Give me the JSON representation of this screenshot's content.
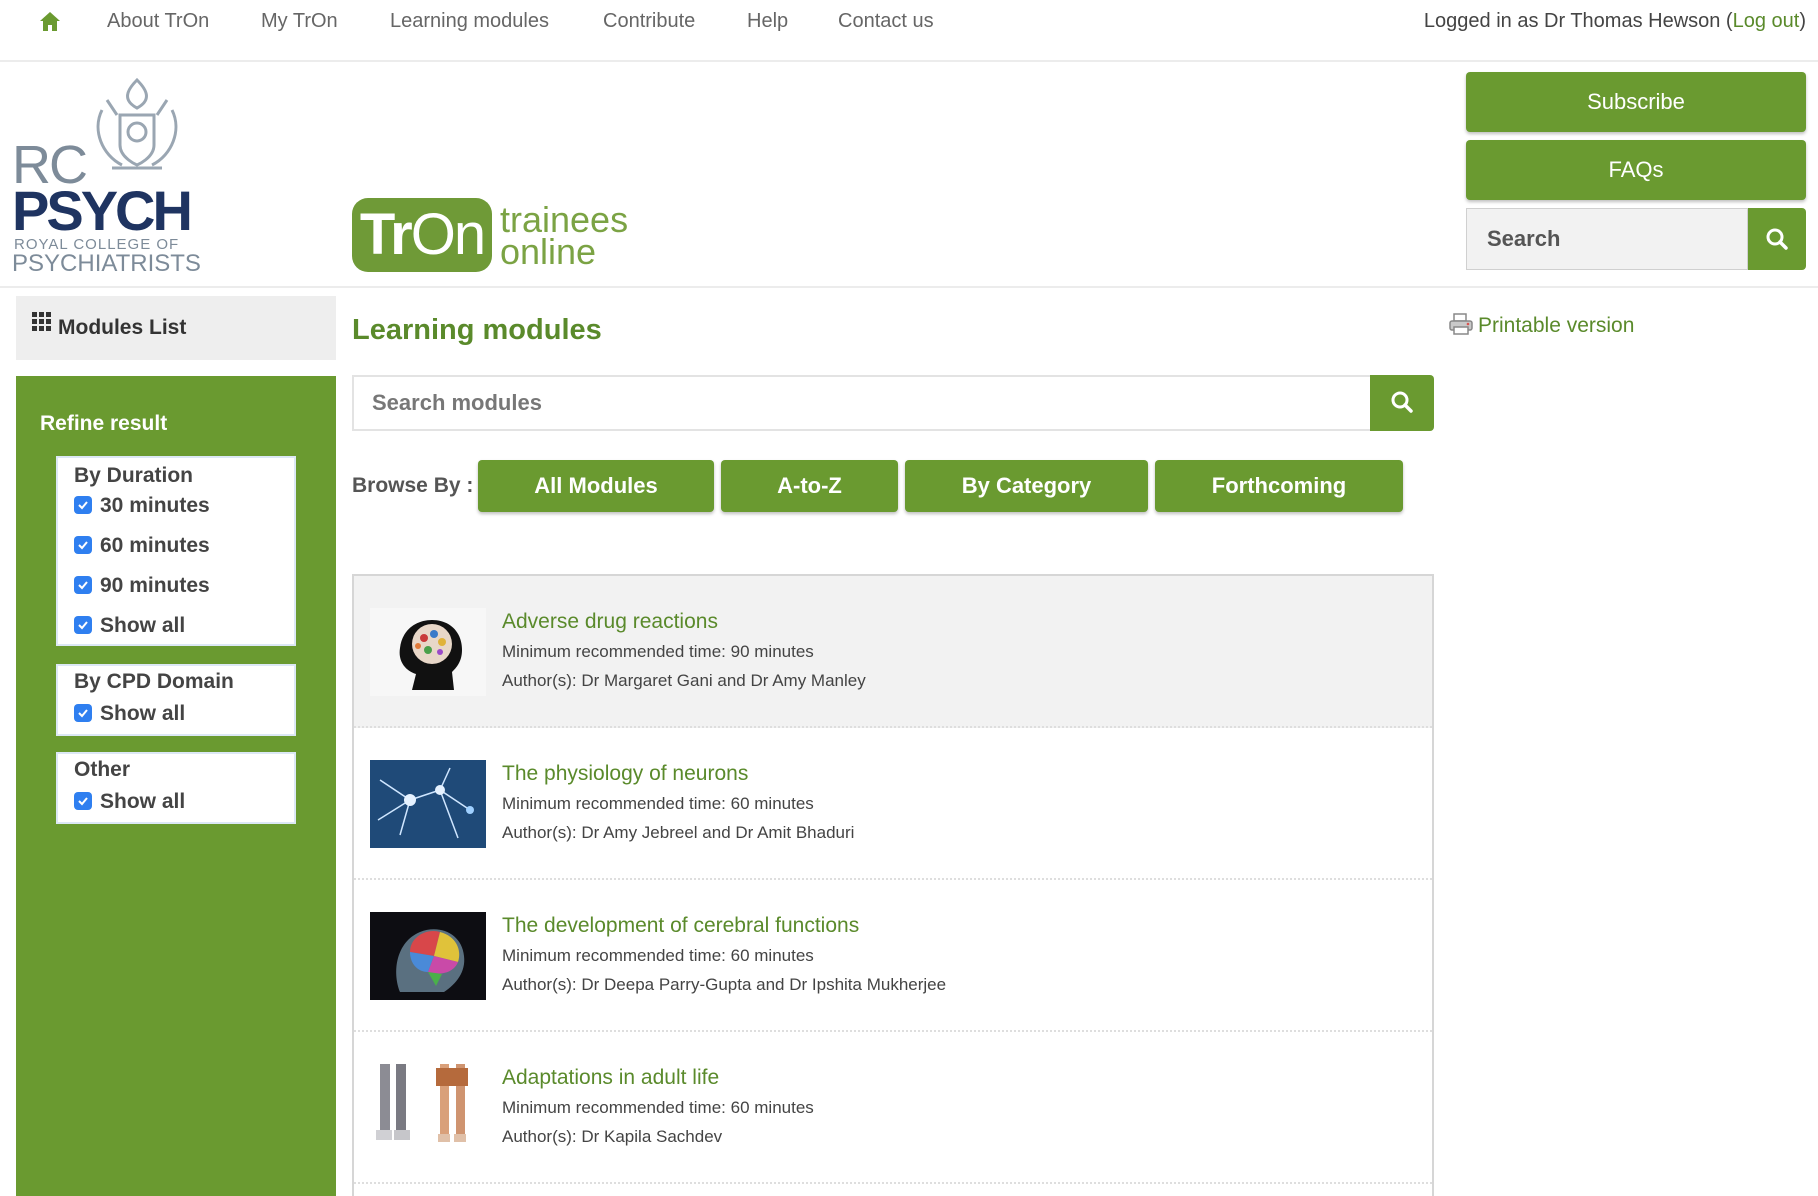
{
  "topnav": {
    "items": [
      "About TrOn",
      "My TrOn",
      "Learning modules",
      "Contribute",
      "Help",
      "Contact us"
    ],
    "login_prefix": "Logged in as Dr Thomas Hewson (",
    "logout": "Log out",
    "login_suffix": ")"
  },
  "header": {
    "rc_logo": {
      "line1": "RC",
      "line2": "PSYCH",
      "line3": "ROYAL COLLEGE OF",
      "line4": "PSYCHIATRISTS"
    },
    "tron_logo": {
      "tr": "Tr",
      "on": "On",
      "sub1": "trainees",
      "sub2": "online"
    },
    "subscribe": "Subscribe",
    "faqs": "FAQs",
    "search_placeholder": "Search"
  },
  "sidebar": {
    "modules_list": "Modules List",
    "refine_title": "Refine result",
    "groups": [
      {
        "title": "By Duration",
        "options": [
          "30 minutes",
          "60 minutes",
          "90 minutes",
          "Show all"
        ]
      },
      {
        "title": "By CPD Domain",
        "options": [
          "Show all"
        ]
      },
      {
        "title": "Other",
        "options": [
          "Show all"
        ]
      }
    ]
  },
  "main": {
    "title": "Learning modules",
    "printable": "Printable version",
    "search_placeholder": "Search modules",
    "browse_label": "Browse By :",
    "browse_buttons": [
      "All Modules",
      "A-to-Z",
      "By Category",
      "Forthcoming"
    ],
    "modules": [
      {
        "title": "Adverse drug reactions",
        "time": "Minimum recommended time: 90 minutes",
        "authors": "Author(s): Dr Margaret Gani and Dr Amy Manley"
      },
      {
        "title": "The physiology of neurons",
        "time": "Minimum recommended time: 60 minutes",
        "authors": "Author(s): Dr Amy Jebreel and Dr Amit Bhaduri"
      },
      {
        "title": "The development of cerebral functions",
        "time": "Minimum recommended time: 60 minutes",
        "authors": "Author(s): Dr Deepa Parry-Gupta and Dr Ipshita Mukherjee"
      },
      {
        "title": "Adaptations in adult life",
        "time": "Minimum recommended time: 60 minutes",
        "authors": "Author(s): Dr Kapila Sachdev"
      }
    ]
  },
  "colors": {
    "brand_green": "#6a9a30",
    "link_green": "#5a8a2b",
    "checkbox_blue": "#2f7ff0"
  },
  "icons": [
    "home-icon",
    "search-icon",
    "grid-icon",
    "printer-icon",
    "checkbox-checked-icon"
  ]
}
